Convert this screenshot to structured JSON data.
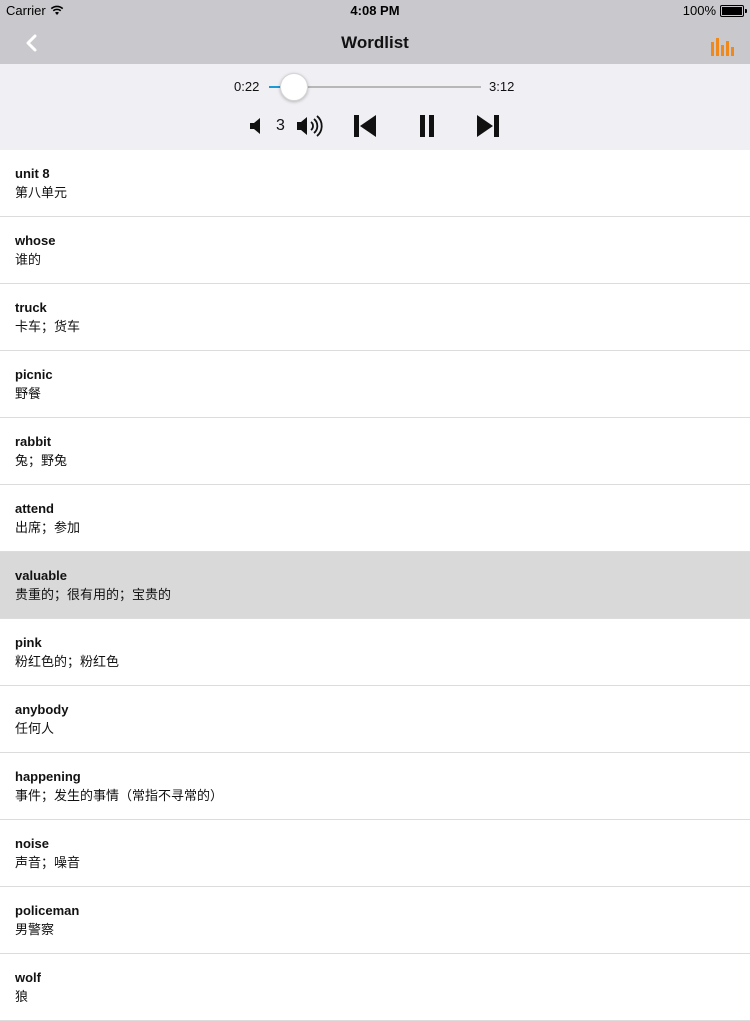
{
  "status_bar": {
    "carrier": "Carrier",
    "time": "4:08 PM",
    "battery": "100%",
    "battery_level": 1.0
  },
  "nav": {
    "title": "Wordlist",
    "back_icon": "chevron-left-icon",
    "menu_icon": "equalizer-icon",
    "accent_color": "#f0891a"
  },
  "player": {
    "current_time": "0:22",
    "total_time": "3:12",
    "progress": 0.115,
    "volume_level": "3",
    "slider_color": "#1c9ad6"
  },
  "words": [
    {
      "word": "unit 8",
      "meaning": "第八单元"
    },
    {
      "word": "whose",
      "meaning": "谁的"
    },
    {
      "word": "truck",
      "meaning": "卡车；货车"
    },
    {
      "word": "picnic",
      "meaning": "野餐"
    },
    {
      "word": "rabbit",
      "meaning": "兔；野兔"
    },
    {
      "word": "attend",
      "meaning": "出席；参加"
    },
    {
      "word": "valuable",
      "meaning": "贵重的；很有用的；宝贵的",
      "selected": true
    },
    {
      "word": "pink",
      "meaning": "粉红色的；粉红色"
    },
    {
      "word": "anybody",
      "meaning": "任何人"
    },
    {
      "word": "happening",
      "meaning": "事件；发生的事情（常指不寻常的）"
    },
    {
      "word": "noise",
      "meaning": "声音；噪音"
    },
    {
      "word": "policeman",
      "meaning": "男警察"
    },
    {
      "word": "wolf",
      "meaning": "狼"
    }
  ]
}
